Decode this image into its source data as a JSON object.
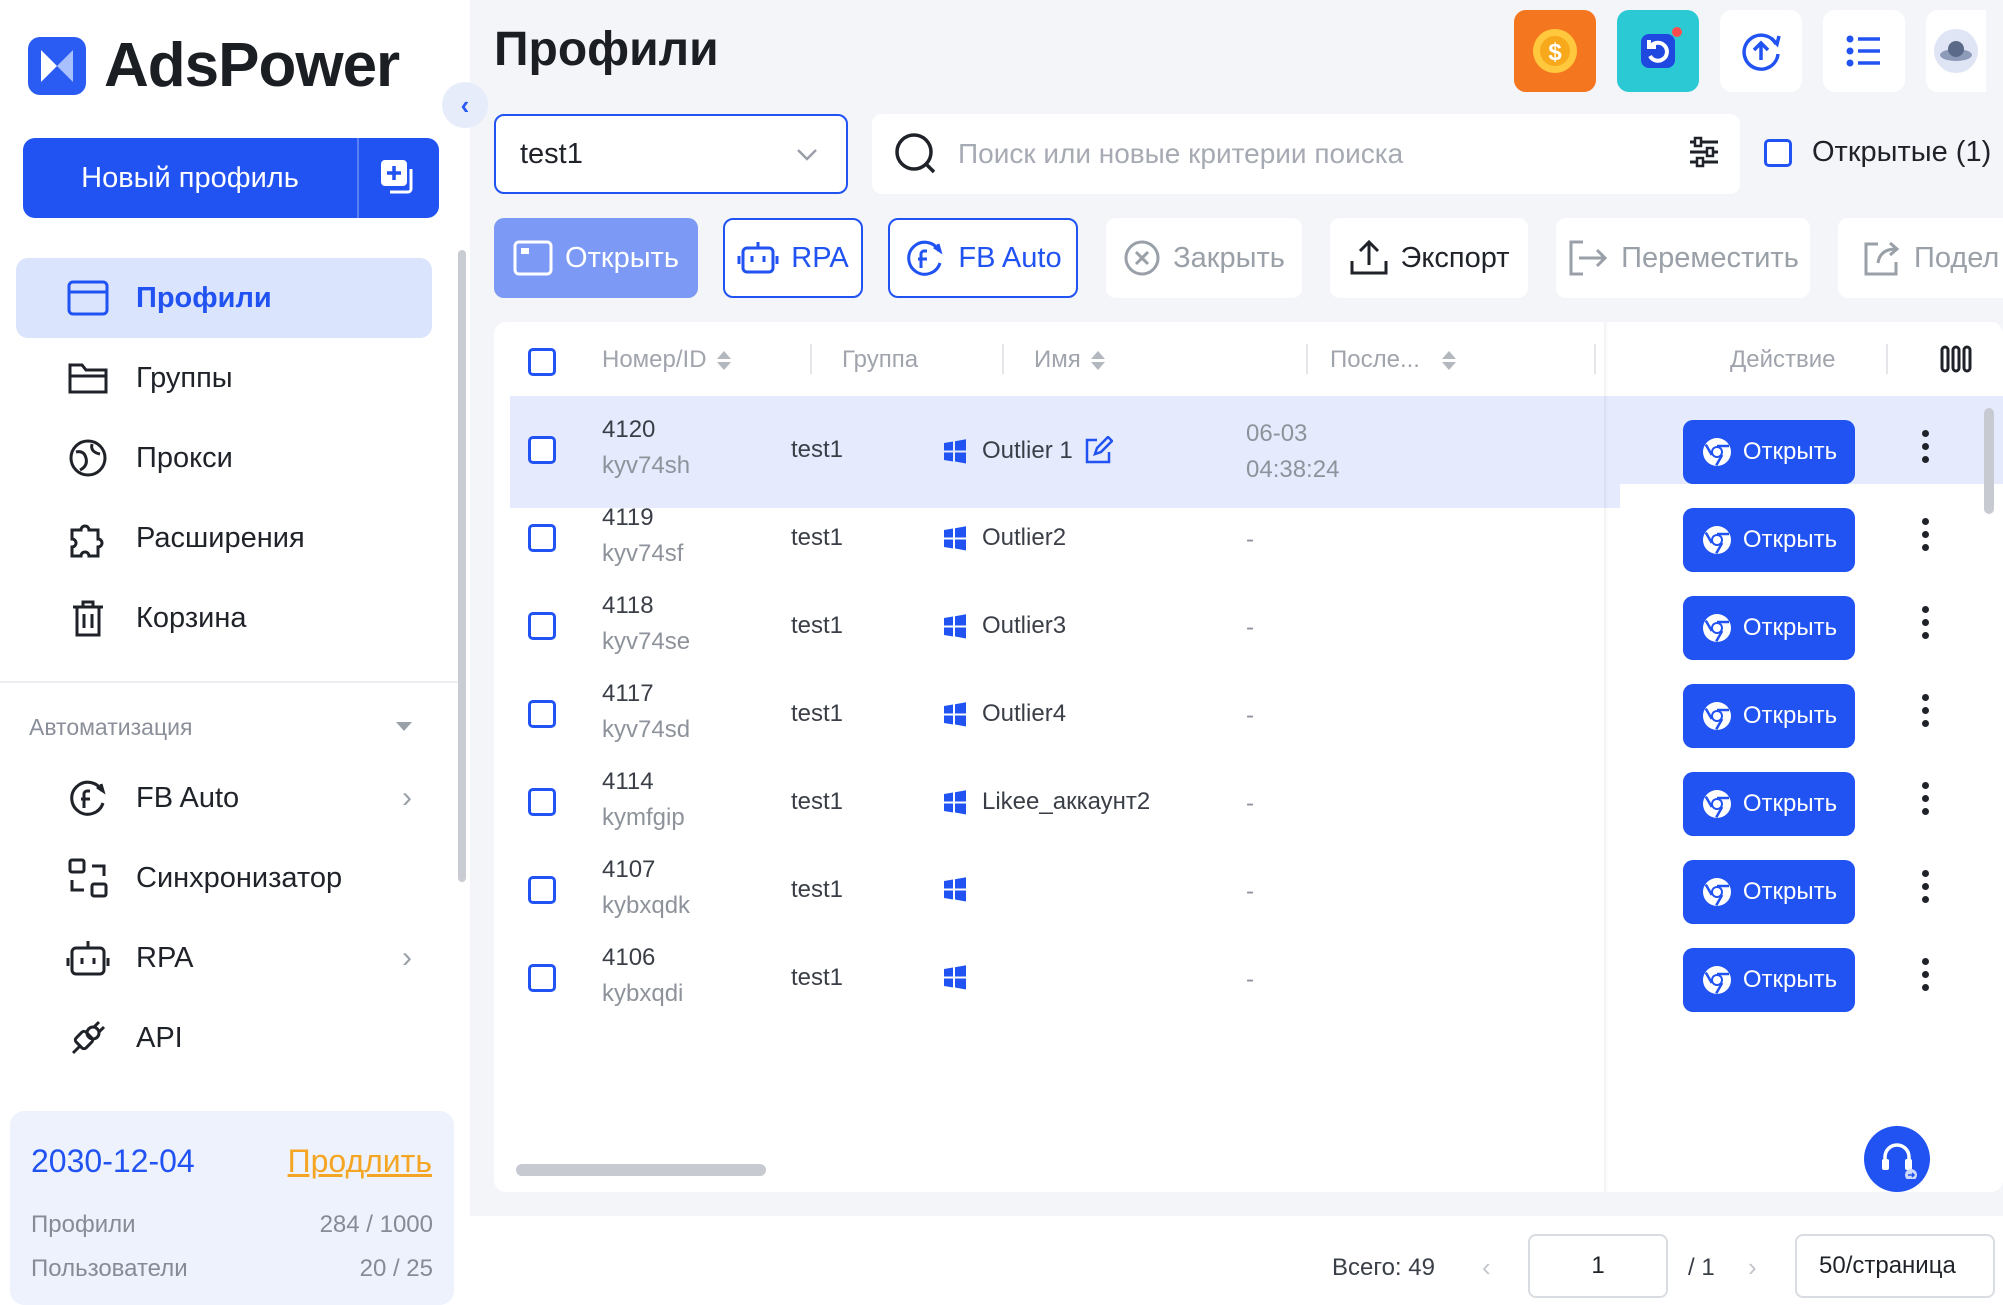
{
  "app": {
    "brand": "AdsPower",
    "accent": "#2152f2"
  },
  "sidebar": {
    "new_profile_label": "Новый профиль",
    "items": [
      {
        "label": "Профили",
        "icon": "browser-window-icon",
        "active": true
      },
      {
        "label": "Группы",
        "icon": "folder-icon"
      },
      {
        "label": "Прокси",
        "icon": "proxy-globe-icon"
      },
      {
        "label": "Расширения",
        "icon": "puzzle-icon"
      },
      {
        "label": "Корзина",
        "icon": "trash-icon"
      }
    ],
    "automation_title": "Автоматизация",
    "automation_items": [
      {
        "label": "FB Auto",
        "icon": "facebook-auto-icon",
        "has_submenu": true
      },
      {
        "label": "Синхронизатор",
        "icon": "sync-icon",
        "has_submenu": false
      },
      {
        "label": "RPA",
        "icon": "robot-icon",
        "has_submenu": true
      },
      {
        "label": "API",
        "icon": "plug-icon",
        "has_submenu": false
      }
    ],
    "plan": {
      "expiry_date": "2030-12-04",
      "renew_label": "Продлить",
      "profiles_label": "Профили",
      "profiles_value": "284 / 1000",
      "users_label": "Пользователи",
      "users_value": "20 / 25"
    }
  },
  "header": {
    "title": "Профили",
    "icons": [
      "coin-icon",
      "refresh-app-icon",
      "upload-sync-icon",
      "list-icon",
      "avatar-icon"
    ]
  },
  "filters": {
    "group_value": "test1",
    "search_placeholder": "Поиск или новые критерии поиска",
    "opened_label": "Открытые (1)"
  },
  "toolbar": {
    "open": "Открыть",
    "rpa": "RPA",
    "fb_auto": "FB Auto",
    "close": "Закрыть",
    "export": "Экспорт",
    "move": "Переместить",
    "share": "Подел"
  },
  "table": {
    "columns": {
      "id": "Номер/ID",
      "group": "Группа",
      "name": "Имя",
      "last": "После...",
      "action": "Действие"
    },
    "open_label": "Открыть",
    "rows": [
      {
        "num": "4120",
        "id": "kyv74sh",
        "group": "test1",
        "name": "Outlier 1",
        "last_date": "06-03",
        "last_time": "04:38:24",
        "highlight": true
      },
      {
        "num": "4119",
        "id": "kyv74sf",
        "group": "test1",
        "name": "Outlier2",
        "last_date": "-",
        "last_time": ""
      },
      {
        "num": "4118",
        "id": "kyv74se",
        "group": "test1",
        "name": "Outlier3",
        "last_date": "-",
        "last_time": ""
      },
      {
        "num": "4117",
        "id": "kyv74sd",
        "group": "test1",
        "name": "Outlier4",
        "last_date": "-",
        "last_time": ""
      },
      {
        "num": "4114",
        "id": "kymfgip",
        "group": "test1",
        "name": "Likee_аккаунт2",
        "last_date": "-",
        "last_time": ""
      },
      {
        "num": "4107",
        "id": "kybxqdk",
        "group": "test1",
        "name": "",
        "last_date": "-",
        "last_time": ""
      },
      {
        "num": "4106",
        "id": "kybxqdi",
        "group": "test1",
        "name": "",
        "last_date": "-",
        "last_time": ""
      }
    ]
  },
  "footer": {
    "total": "Всего: 49",
    "page": "1",
    "of_pages": "/ 1",
    "page_size": "50/страница"
  }
}
